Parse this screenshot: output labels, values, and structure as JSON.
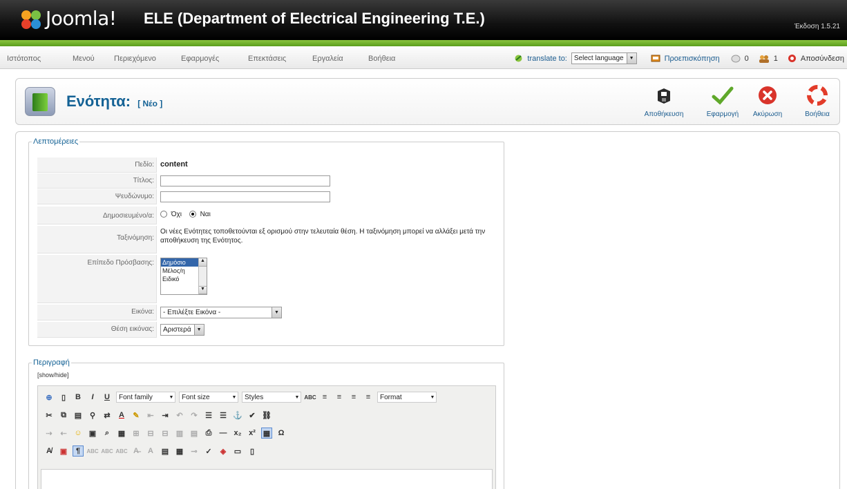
{
  "header": {
    "logo_text": "Joomla!",
    "site_title": "ELE (Department of Electrical Engineering T.E.)",
    "version": "Έκδοση 1.5.21"
  },
  "menu": {
    "items": [
      "Ιστότοπος",
      "Μενού",
      "Περιεχόμενο",
      "Εφαρμογές",
      "Επεκτάσεις",
      "Εργαλεία",
      "Βοήθεια"
    ],
    "translate_label": "translate to:",
    "language_select": "Select language",
    "preview": "Προεπισκόπηση",
    "messages_count": "0",
    "users_count": "1",
    "logout": "Αποσύνδεση"
  },
  "toolbar": {
    "title": "Ενότητα:",
    "subtitle": "[ Νέο ]",
    "buttons": [
      "Αποθήκευση",
      "Εφαρμογή",
      "Ακύρωση",
      "Βοήθεια"
    ]
  },
  "details": {
    "legend": "Λεπτομέρειες",
    "scope_label": "Πεδίο:",
    "scope_value": "content",
    "title_label": "Τίτλος:",
    "title_value": "",
    "alias_label": "Ψευδώνυμο:",
    "alias_value": "",
    "published_label": "Δημοσιευμένο/α:",
    "published_no": "Όχι",
    "published_yes": "Ναι",
    "ordering_label": "Ταξινόμηση:",
    "ordering_text": "Οι νέες Ενότητες τοποθετούνται εξ ορισμού στην τελευταία θέση. Η ταξινόμηση μπορεί να αλλάξει μετά την αποθήκευση της Ενότητος.",
    "access_label": "Επίπεδο Πρόσβασης:",
    "access_options": [
      "Δημόσιο",
      "Μέλος/η",
      "Ειδικό"
    ],
    "image_label": "Εικόνα:",
    "image_value": "- Επιλέξτε Εικόνα -",
    "image_position_label": "Θέση εικόνας:",
    "image_position_value": "Αριστερά"
  },
  "description": {
    "legend": "Περιγραφή",
    "showhide": "[show/hide]",
    "font_family": "Font family",
    "font_size": "Font size",
    "styles": "Styles",
    "format": "Format"
  }
}
